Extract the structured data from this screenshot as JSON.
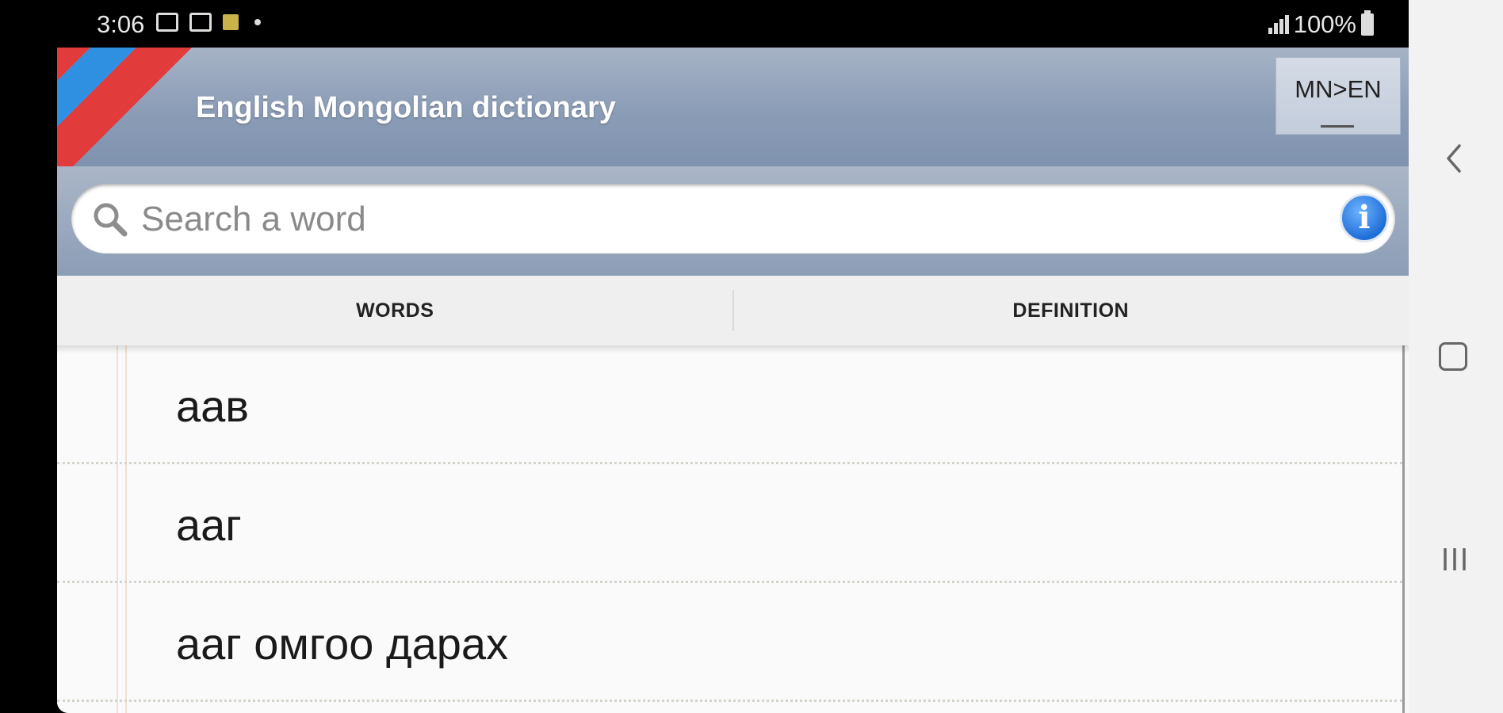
{
  "status_bar": {
    "time": "3:06",
    "battery": "100%",
    "icons": [
      "image-icon",
      "ad-icon",
      "notification-icon",
      "dot-icon",
      "signal-icon",
      "battery-icon"
    ]
  },
  "header": {
    "title": "English Mongolian dictionary",
    "lang_toggle": "MN>EN",
    "flag_colors": [
      "#e23b3b",
      "#2f8fe0"
    ]
  },
  "search": {
    "placeholder": "Search a word",
    "value": "",
    "info_glyph": "i"
  },
  "tabs": [
    {
      "label": "WORDS"
    },
    {
      "label": "DEFINITION"
    }
  ],
  "words": [
    {
      "text": "аав"
    },
    {
      "text": "ааг"
    },
    {
      "text": "ааг омгоо дарах"
    }
  ],
  "navbar": {
    "buttons": [
      "back-icon",
      "home-icon",
      "recent-apps-icon"
    ]
  }
}
